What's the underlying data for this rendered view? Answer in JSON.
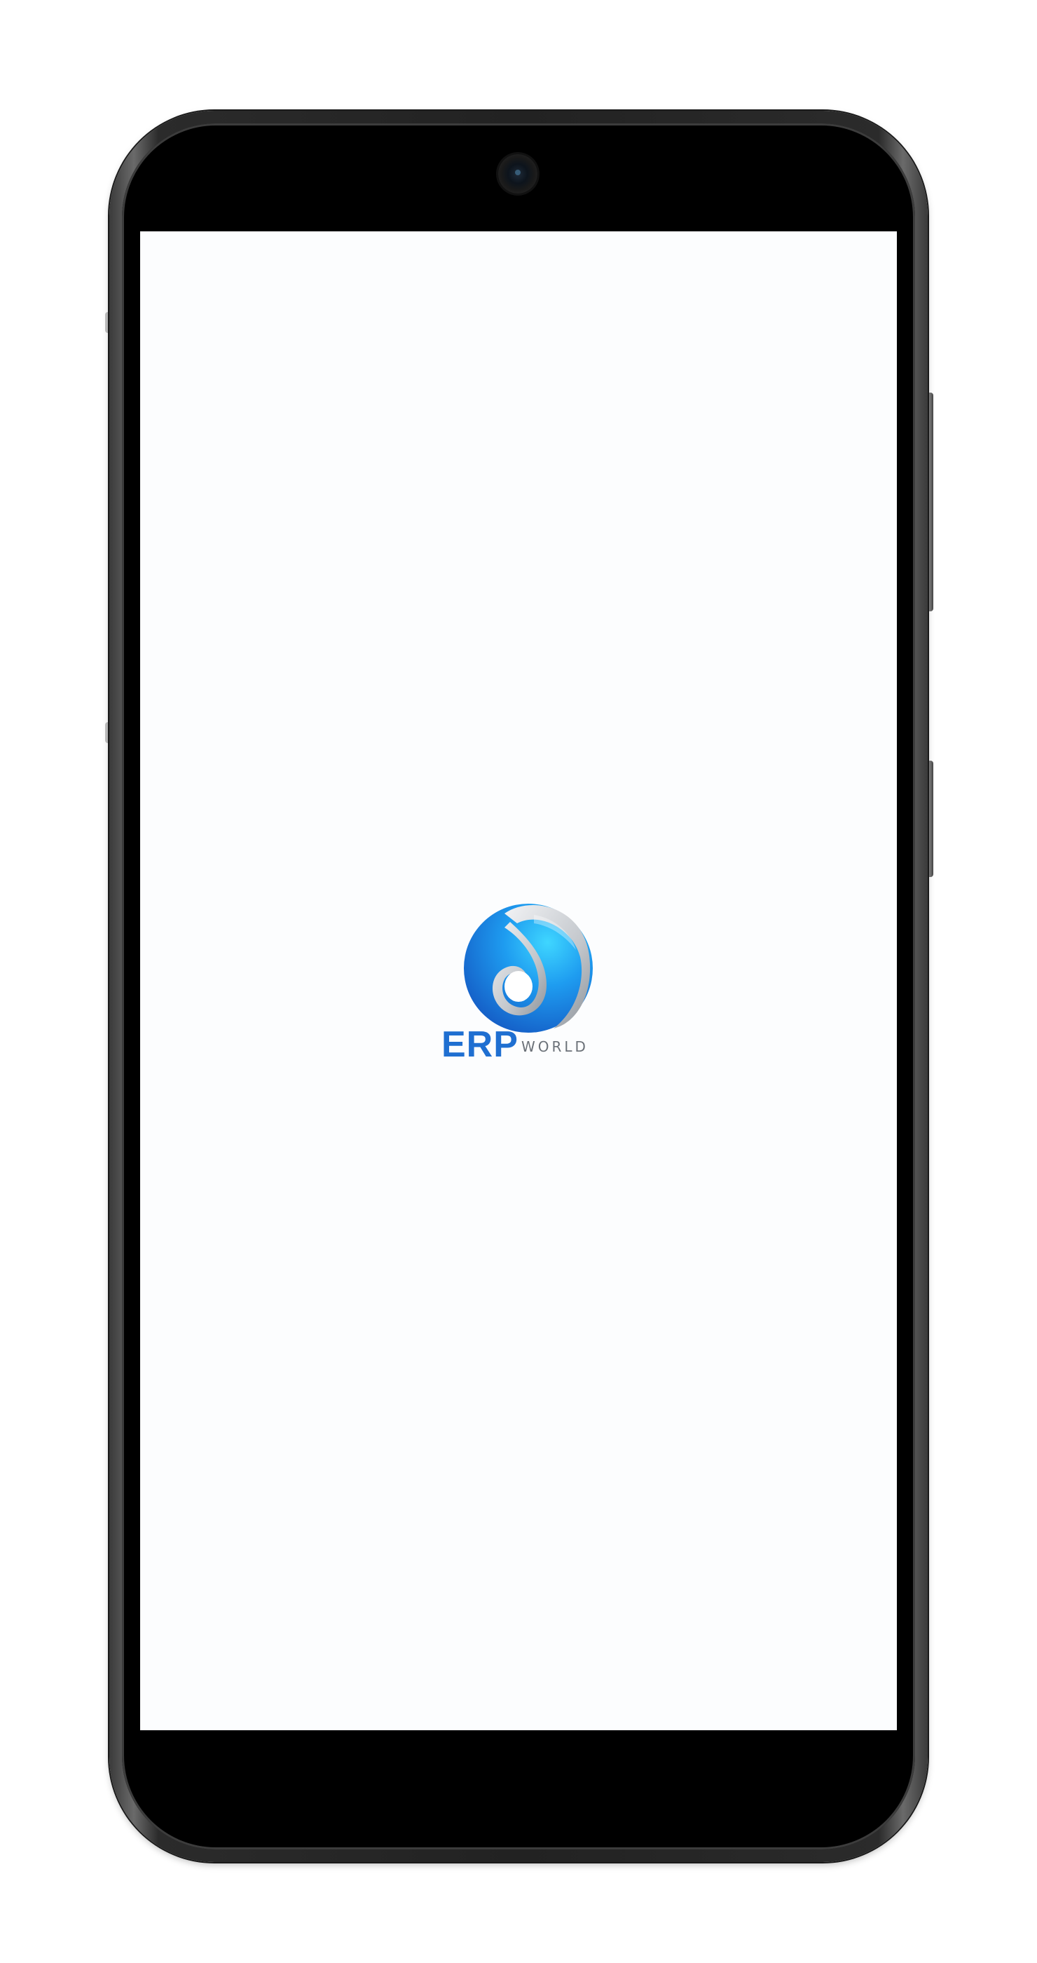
{
  "device": {
    "frame_color": "#2a2a2a",
    "screen_background": "#fcfdfe"
  },
  "splash": {
    "logo": {
      "brand": "ERP",
      "suffix": "WORLD",
      "brand_color": "#1f6fd1",
      "suffix_color": "#6b7178",
      "primary_color": "#1e8fe8",
      "accent_color": "#27c4f5",
      "swirl_color": "#c9ccd0"
    }
  }
}
